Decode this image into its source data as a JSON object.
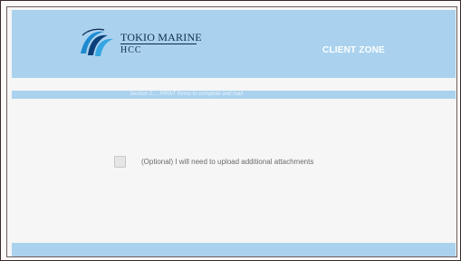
{
  "header": {
    "logo": {
      "line1": "TOKIO MARINE",
      "line2": "HCC"
    },
    "title": "CLIENT ZONE"
  },
  "section": {
    "label": "Section 2.... PRINT forms to complete and mail"
  },
  "form": {
    "optional_attachments": {
      "label": "(Optional) I will need to upload additional attachments",
      "checked": false
    }
  },
  "colors": {
    "brand_light_blue": "#aad2ee",
    "brand_navy": "#0d2a52",
    "background": "#f6f6f6"
  }
}
